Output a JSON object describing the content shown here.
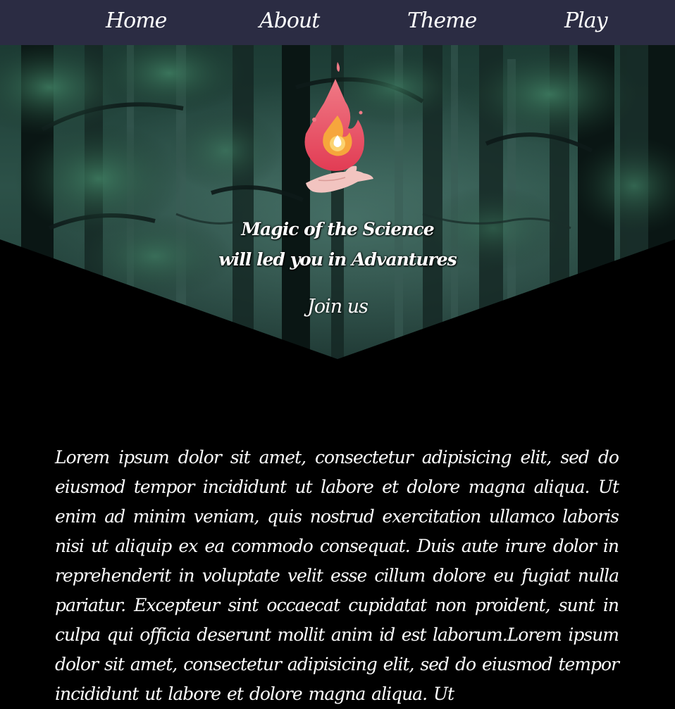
{
  "nav": {
    "items": [
      {
        "label": "Home"
      },
      {
        "label": "About"
      },
      {
        "label": "Theme"
      },
      {
        "label": "Play"
      }
    ]
  },
  "hero": {
    "title_line1": "Magic of the Science",
    "title_line2": "will led you in Advantures",
    "cta_label": "Join us",
    "logo_icon": "flame-in-hand-icon"
  },
  "content": {
    "paragraph": "Lorem ipsum dolor sit amet, consectetur adipisicing elit, sed do eiusmod tempor incididunt ut labore et dolore magna aliqua. Ut enim ad minim veniam, quis nostrud exercitation ullamco laboris nisi ut aliquip ex ea commodo consequat. Duis aute irure dolor in reprehenderit in voluptate velit esse cillum dolore eu fugiat nulla pariatur. Excepteur sint occaecat cupidatat non proident, sunt in culpa qui officia deserunt mollit anim id est laborum.Lorem ipsum dolor sit amet, consectetur adipisicing elit, sed do eiusmod tempor incididunt ut labore et dolore magna aliqua. Ut"
  },
  "colors": {
    "nav_background": "#2b2c43",
    "page_background": "#000000",
    "text": "#ffffff",
    "flame_outer": "#e8485e",
    "flame_inner": "#f6a63c",
    "hand": "#f2c4c0"
  }
}
